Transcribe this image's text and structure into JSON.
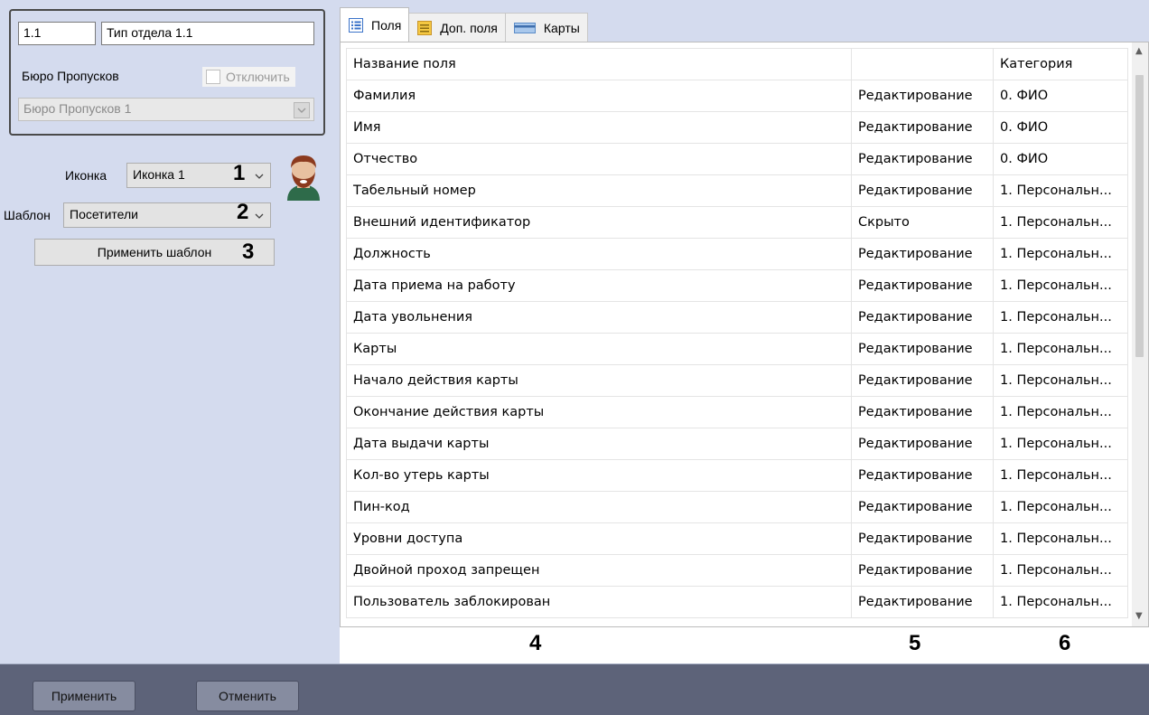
{
  "left": {
    "id_value": "1.1",
    "name_value": "Тип отдела 1.1",
    "bureau_label": "Бюро Пропусков",
    "disable_label": "Отключить",
    "bureau_select_value": "Бюро Пропусков 1",
    "icon_label": "Иконка",
    "icon_value": "Иконка 1",
    "template_label": "Шаблон",
    "template_value": "Посетители",
    "apply_template_label": "Применить шаблон",
    "annotations": [
      "1",
      "2",
      "3"
    ]
  },
  "tabs": [
    {
      "label": "Поля",
      "icon": "list-icon",
      "active": true
    },
    {
      "label": "Доп. поля",
      "icon": "extra-fields-icon",
      "active": false
    },
    {
      "label": "Карты",
      "icon": "card-icon",
      "active": false
    }
  ],
  "grid": {
    "headers": [
      "Название поля",
      "",
      "Категория"
    ],
    "rows": [
      [
        "Фамилия",
        "Редактирование",
        "0. ФИО"
      ],
      [
        "Имя",
        "Редактирование",
        "0. ФИО"
      ],
      [
        "Отчество",
        "Редактирование",
        "0. ФИО"
      ],
      [
        "Табельный номер",
        "Редактирование",
        "1. Персональн..."
      ],
      [
        "Внешний идентификатор",
        "Скрыто",
        "1. Персональн..."
      ],
      [
        "Должность",
        "Редактирование",
        "1. Персональн..."
      ],
      [
        "Дата приема на работу",
        "Редактирование",
        "1. Персональн..."
      ],
      [
        "Дата увольнения",
        "Редактирование",
        "1. Персональн..."
      ],
      [
        "Карты",
        "Редактирование",
        "1. Персональн..."
      ],
      [
        "Начало действия карты",
        "Редактирование",
        "1. Персональн..."
      ],
      [
        "Окончание действия карты",
        "Редактирование",
        "1. Персональн..."
      ],
      [
        "Дата выдачи карты",
        "Редактирование",
        "1. Персональн..."
      ],
      [
        "Кол-во утерь карты",
        "Редактирование",
        "1. Персональн..."
      ],
      [
        "Пин-код",
        "Редактирование",
        "1. Персональн..."
      ],
      [
        "Уровни доступа",
        "Редактирование",
        "1. Персональн..."
      ],
      [
        "Двойной проход запрещен",
        "Редактирование",
        "1. Персональн..."
      ],
      [
        "Пользователь заблокирован",
        "Редактирование",
        "1. Персональн..."
      ]
    ],
    "column_annotations": [
      "4",
      "5",
      "6"
    ]
  },
  "footer": {
    "apply_label": "Применить",
    "cancel_label": "Отменить"
  },
  "colors": {
    "panel_bg": "#d4dbee",
    "footer_bg": "#5d6379"
  }
}
